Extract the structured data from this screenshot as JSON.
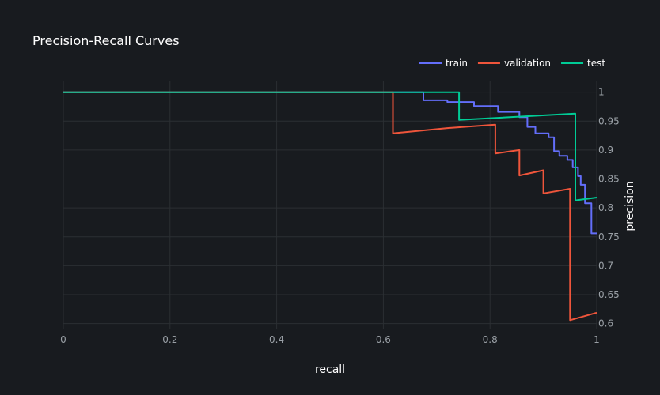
{
  "chart_data": {
    "type": "line",
    "title": "Precision-Recall Curves",
    "xlabel": "recall",
    "ylabel": "precision",
    "xlim": [
      0,
      1
    ],
    "ylim": [
      0.59,
      1.02
    ],
    "x_ticks": [
      0,
      0.2,
      0.4,
      0.6,
      0.8,
      1
    ],
    "x_tick_labels": [
      "0",
      "0.2",
      "0.4",
      "0.6",
      "0.8",
      "1"
    ],
    "y_ticks": [
      0.6,
      0.65,
      0.7,
      0.75,
      0.8,
      0.85,
      0.9,
      0.95,
      1
    ],
    "y_tick_labels": [
      "0.6",
      "0.65",
      "0.7",
      "0.75",
      "0.8",
      "0.85",
      "0.9",
      "0.95",
      "1"
    ],
    "y_axis_side": "right",
    "grid": true,
    "legend_position": "top-right",
    "legend_orientation": "horizontal",
    "series": [
      {
        "name": "train",
        "color": "#636efa",
        "line_shape": "step",
        "x": [
          0,
          0.675,
          0.675,
          0.72,
          0.72,
          0.77,
          0.77,
          0.815,
          0.815,
          0.855,
          0.855,
          0.87,
          0.87,
          0.885,
          0.885,
          0.91,
          0.91,
          0.92,
          0.92,
          0.93,
          0.93,
          0.945,
          0.945,
          0.955,
          0.955,
          0.965,
          0.965,
          0.97,
          0.97,
          0.978,
          0.978,
          0.99,
          0.99,
          1.0
        ],
        "y": [
          1.0,
          1.0,
          0.986,
          0.986,
          0.983,
          0.983,
          0.976,
          0.976,
          0.966,
          0.966,
          0.957,
          0.957,
          0.94,
          0.94,
          0.929,
          0.929,
          0.922,
          0.922,
          0.898,
          0.898,
          0.89,
          0.89,
          0.883,
          0.883,
          0.87,
          0.87,
          0.855,
          0.855,
          0.84,
          0.84,
          0.808,
          0.808,
          0.756,
          0.756
        ]
      },
      {
        "name": "validation",
        "color": "#ef553b",
        "line_shape": "step",
        "x": [
          0,
          0.618,
          0.618,
          0.72,
          0.81,
          0.81,
          0.855,
          0.855,
          0.9,
          0.9,
          0.95,
          0.95,
          1.0
        ],
        "y": [
          1.0,
          1.0,
          0.929,
          0.938,
          0.944,
          0.894,
          0.9,
          0.856,
          0.865,
          0.825,
          0.833,
          0.606,
          0.619
        ]
      },
      {
        "name": "test",
        "color": "#00cc96",
        "line_shape": "step",
        "x": [
          0,
          0.742,
          0.742,
          0.96,
          0.96,
          1.0
        ],
        "y": [
          1.0,
          1.0,
          0.952,
          0.963,
          0.813,
          0.818
        ]
      }
    ]
  }
}
